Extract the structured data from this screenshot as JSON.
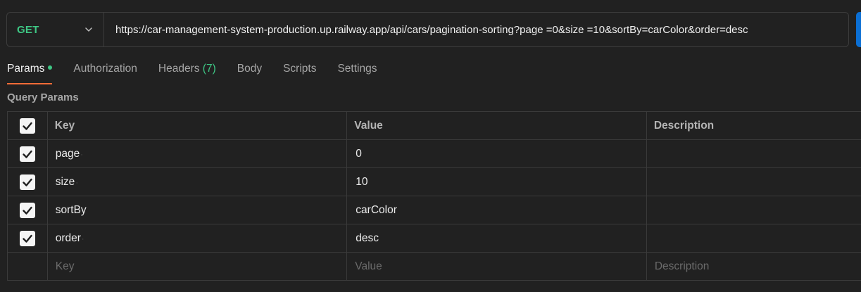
{
  "request": {
    "method": "GET",
    "url": "https://car-management-system-production.up.railway.app/api/cars/pagination-sorting?page =0&size =10&sortBy=carColor&order=desc"
  },
  "tabs": [
    {
      "label": "Params",
      "active": true
    },
    {
      "label": "Authorization"
    },
    {
      "label": "Headers",
      "count": "(7)"
    },
    {
      "label": "Body"
    },
    {
      "label": "Scripts"
    },
    {
      "label": "Settings"
    }
  ],
  "section_title": "Query Params",
  "table": {
    "headers": {
      "key": "Key",
      "value": "Value",
      "description": "Description"
    },
    "rows": [
      {
        "key": "page",
        "value": "0",
        "description": ""
      },
      {
        "key": "size",
        "value": "10",
        "description": ""
      },
      {
        "key": "sortBy",
        "value": "carColor",
        "description": ""
      },
      {
        "key": "order",
        "value": "desc",
        "description": ""
      }
    ],
    "placeholders": {
      "key": "Key",
      "value": "Value",
      "description": "Description"
    }
  },
  "colors": {
    "method_green": "#3ec784",
    "active_tab_underline": "#ff6c37",
    "background": "#212121",
    "send_button_blue": "#0b6fd4"
  }
}
